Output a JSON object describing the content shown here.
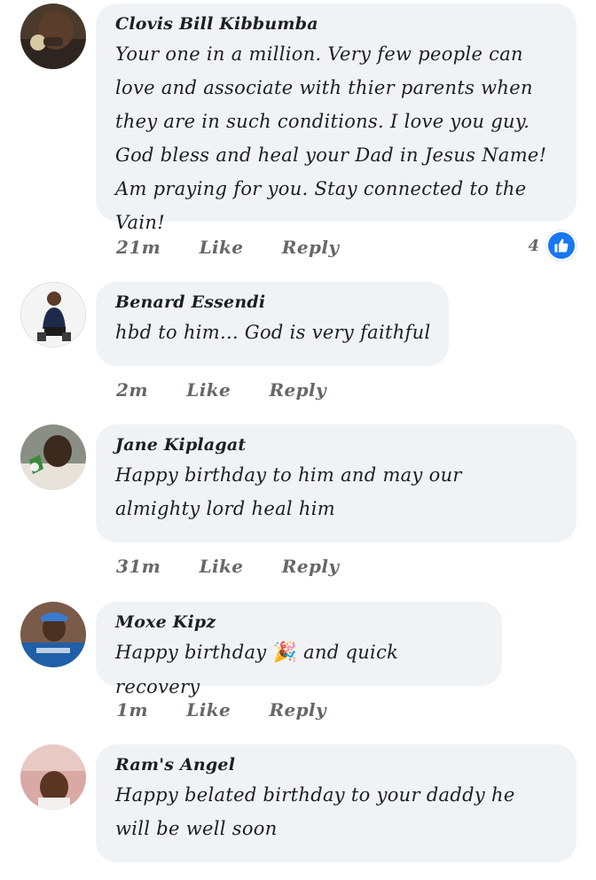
{
  "comments": [
    {
      "author": "Clovis Bill Kibbumba",
      "text": "Your one in a million. Very few people can love and associate with thier parents when they are in such conditions. I love you guy. God bless and heal your Dad in Jesus Name! Am praying for you. Stay connected to the Vain!",
      "time": "21m",
      "like_label": "Like",
      "reply_label": "Reply",
      "reaction_count": "4",
      "reaction_icon": "like-thumbs-up-icon",
      "accent_color": "#1877f2"
    },
    {
      "author": "Benard Essendi",
      "text": "hbd to him... God is very faithful",
      "time": "2m",
      "like_label": "Like",
      "reply_label": "Reply"
    },
    {
      "author": "Jane Kiplagat",
      "text": "Happy birthday to him and may our almighty lord heal him",
      "time": "31m",
      "like_label": "Like",
      "reply_label": "Reply"
    },
    {
      "author": "Moxe Kipz",
      "text_before_emoji": "Happy birthday",
      "emoji": "🎉",
      "text_after_emoji": "and quick recovery",
      "time": "1m",
      "like_label": "Like",
      "reply_label": "Reply"
    },
    {
      "author": "Ram's Angel",
      "text": "Happy belated birthday to your daddy he will be well soon"
    }
  ]
}
